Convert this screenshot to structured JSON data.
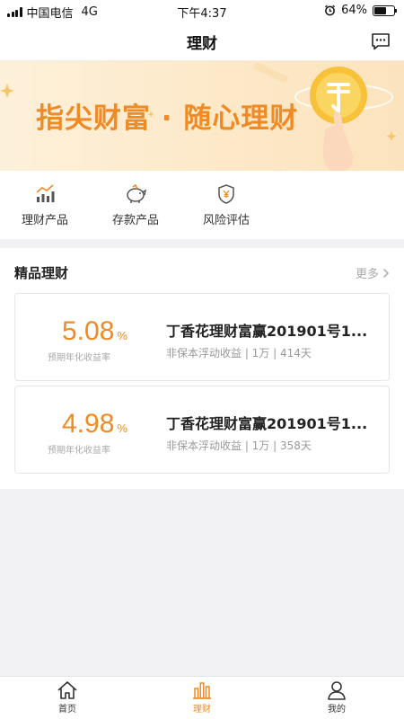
{
  "status": {
    "carrier": "中国电信",
    "network": "4G",
    "time": "下午4:37",
    "battery": "64%",
    "battery_level": 0.64
  },
  "header": {
    "title": "理财"
  },
  "banner": {
    "text": "指尖财富 · 随心理财",
    "coin_symbol": "¥"
  },
  "quick": [
    {
      "label": "理财产品",
      "icon": "chart-icon"
    },
    {
      "label": "存款产品",
      "icon": "piggy-bank-icon"
    },
    {
      "label": "风险评估",
      "icon": "shield-yen-icon"
    }
  ],
  "section": {
    "title": "精品理财",
    "more": "更多",
    "products": [
      {
        "rate": "5.08",
        "pct": "%",
        "rate_label": "预期年化收益率",
        "name": "丁香花理财富赢201901号1...",
        "desc": "非保本浮动收益 | 1万 | 414天"
      },
      {
        "rate": "4.98",
        "pct": "%",
        "rate_label": "预期年化收益率",
        "name": "丁香花理财富赢201901号1...",
        "desc": "非保本浮动收益 | 1万 | 358天"
      }
    ]
  },
  "tabs": [
    {
      "label": "首页",
      "icon": "home-icon",
      "active": false
    },
    {
      "label": "理财",
      "icon": "bar-chart-icon",
      "active": true
    },
    {
      "label": "我的",
      "icon": "user-icon",
      "active": false
    }
  ],
  "colors": {
    "accent": "#f08a24",
    "background": "#f2f2f4",
    "banner": "#fde9c8"
  }
}
